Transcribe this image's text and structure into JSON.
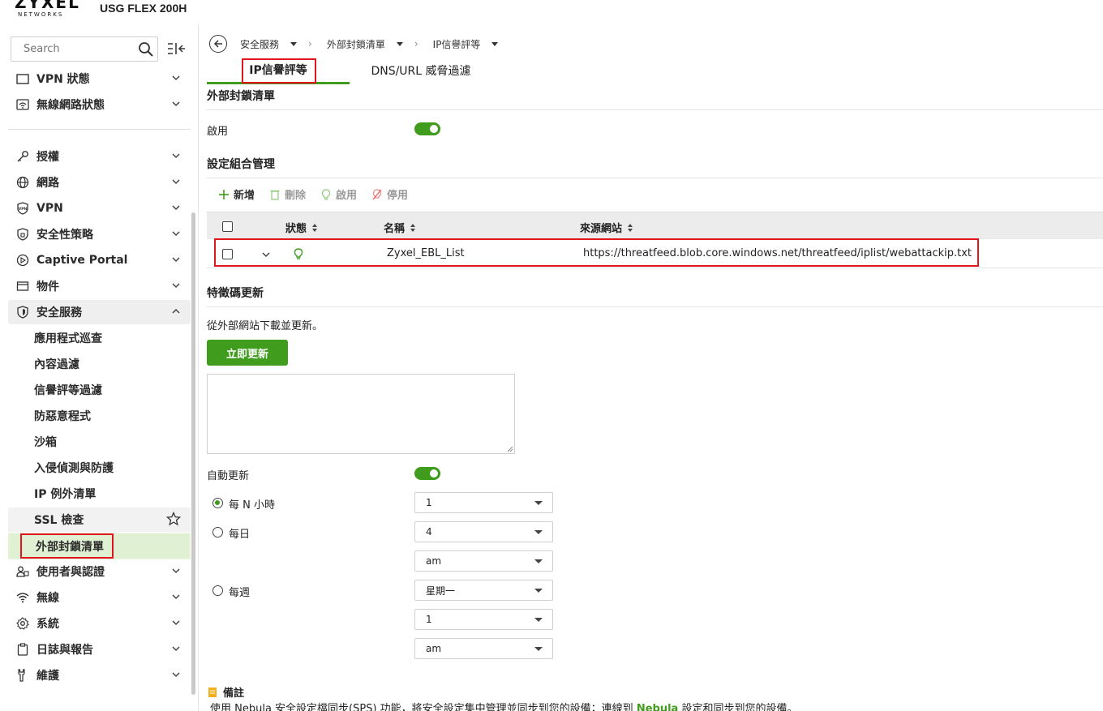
{
  "brand": {
    "logo_main": "ZYXEL",
    "logo_sub": "NETWORKS",
    "product": "USG FLEX 200H"
  },
  "sidebar": {
    "search_placeholder": "Search",
    "items_top": [
      {
        "label": "VPN 狀態"
      },
      {
        "label": "無線網路狀態"
      }
    ],
    "items": [
      {
        "label": "授權"
      },
      {
        "label": "網路"
      },
      {
        "label": "VPN"
      },
      {
        "label": "安全性策略"
      },
      {
        "label": "Captive Portal"
      },
      {
        "label": "物件"
      },
      {
        "label": "安全服務"
      }
    ],
    "sub_items": [
      {
        "label": "應用程式巡查"
      },
      {
        "label": "內容過濾"
      },
      {
        "label": "信譽評等過濾"
      },
      {
        "label": "防惡意程式"
      },
      {
        "label": "沙箱"
      },
      {
        "label": "入侵偵測與防護"
      },
      {
        "label": "IP 例外清單"
      },
      {
        "label": "SSL 檢查"
      },
      {
        "label": "外部封鎖清單"
      }
    ],
    "items_bottom": [
      {
        "label": "使用者與認證"
      },
      {
        "label": "無線"
      },
      {
        "label": "系統"
      },
      {
        "label": "日誌與報告"
      },
      {
        "label": "維護"
      }
    ]
  },
  "breadcrumb": [
    "安全服務",
    "外部封鎖清單",
    "IP信譽評等"
  ],
  "tabs": [
    {
      "label": "IP信譽評等",
      "active": true
    },
    {
      "label": "DNS/URL 威脅過濾",
      "active": false
    }
  ],
  "ebl": {
    "section_title": "外部封鎖清單",
    "enable_label": "啟用",
    "enabled": true
  },
  "profiles": {
    "section_title": "設定組合管理",
    "toolbar": {
      "add": "新增",
      "delete": "刪除",
      "activate": "啟用",
      "deactivate": "停用"
    },
    "columns": {
      "status": "狀態",
      "name": "名稱",
      "source": "來源網站"
    },
    "rows": [
      {
        "name": "Zyxel_EBL_List",
        "source": "https://threatfeed.blob.core.windows.net/threatfeed/iplist/webattackip.txt",
        "active": true
      }
    ]
  },
  "signature": {
    "section_title": "特徵碼更新",
    "description": "從外部網站下載並更新。",
    "update_button": "立即更新",
    "auto_update_label": "自動更新",
    "auto_update": true,
    "schedule": {
      "hourly_label": "每 N 小時",
      "hourly_value": "1",
      "daily_label": "每日",
      "daily_hour": "4",
      "daily_ampm": "am",
      "weekly_label": "每週",
      "weekly_day": "星期一",
      "weekly_hour": "1",
      "weekly_ampm": "am",
      "selected": "hourly"
    }
  },
  "note": {
    "title": "備註",
    "text_before": "使用 Nebula 安全設定檔同步(SPS) 功能，將安全設定集中管理並同步到您的設備；連線到 ",
    "link": "Nebula",
    "text_after": " 設定和同步到您的設備。"
  },
  "colors": {
    "accent": "#3f9c1c",
    "highlight_box": "#e0151d",
    "selected_bg": "#e0f0d2"
  }
}
